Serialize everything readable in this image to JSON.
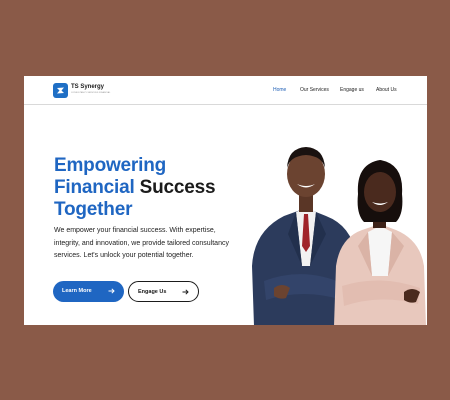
{
  "brand": {
    "name": "TS Synergy",
    "tagline": "CONSULTANCY SERVICES FINANCIAL"
  },
  "nav": {
    "items": [
      {
        "label": "Home",
        "active": true
      },
      {
        "label": "Our Services",
        "active": false
      },
      {
        "label": "Engage us",
        "active": false
      },
      {
        "label": "About Us",
        "active": false
      }
    ]
  },
  "hero": {
    "headline_part1": "Empowering",
    "headline_part2": "Financial",
    "headline_part3": "Success",
    "headline_part4": "Together",
    "description": "We empower your financial success. With expertise, integrity, and innovation, we provide tailored consultancy services. Let's unlock your potential together.",
    "primary_button": "Learn More",
    "secondary_button": "Engage Us"
  },
  "colors": {
    "accent": "#1f66c2",
    "page_background": "#8a5a48"
  },
  "icons": {
    "logo": "ts-logo-icon",
    "arrow": "arrow-right-icon"
  },
  "image": {
    "subject": "hero-photo-two-business-people"
  }
}
